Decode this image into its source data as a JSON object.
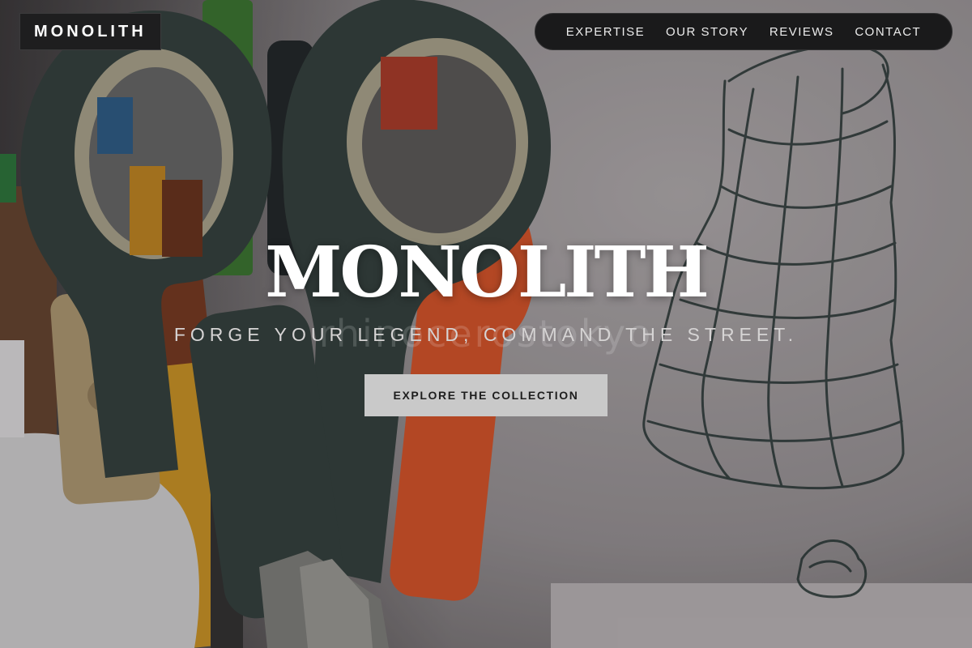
{
  "brand": {
    "logo_text": "MONOLITH"
  },
  "nav": {
    "items": [
      {
        "label": "EXPERTISE"
      },
      {
        "label": "OUR STORY"
      },
      {
        "label": "REVIEWS"
      },
      {
        "label": "CONTACT"
      }
    ]
  },
  "hero": {
    "title": "MONOLITH",
    "tagline": "FORGE YOUR LEGEND, COMMAND THE STREET.",
    "watermark": "rhinocerostokyo",
    "cta_label": "EXPLORE THE COLLECTION",
    "background_description_icon": "scissors-and-pencils-photo"
  },
  "colors": {
    "nav_background": "#1a1a1b",
    "brand_background": "#1e1e1f",
    "cta_background": "#c9c9c9",
    "text_light": "#ffffff"
  }
}
